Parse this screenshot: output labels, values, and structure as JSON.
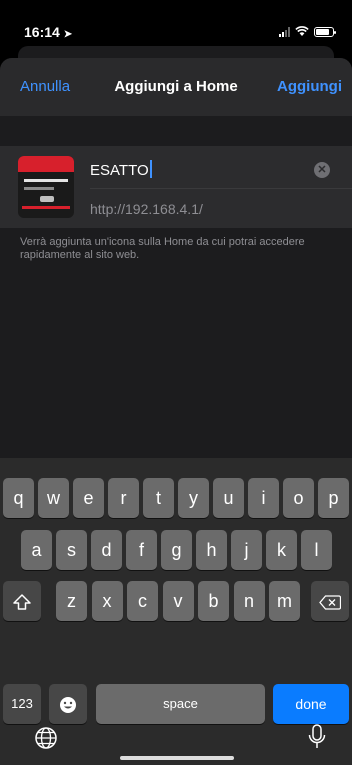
{
  "status": {
    "time": "16:14",
    "battery_level": 0.8
  },
  "nav": {
    "cancel": "Annulla",
    "title": "Aggiungi a Home",
    "add": "Aggiungi"
  },
  "bookmark": {
    "name": "ESATTO",
    "url": "http://192.168.4.1/"
  },
  "description": "Verrà aggiunta un'icona sulla Home da cui potrai accedere rapidamente al sito web.",
  "keyboard": {
    "row1": [
      "q",
      "w",
      "e",
      "r",
      "t",
      "y",
      "u",
      "i",
      "o",
      "p"
    ],
    "row2": [
      "a",
      "s",
      "d",
      "f",
      "g",
      "h",
      "j",
      "k",
      "l"
    ],
    "row3": [
      "z",
      "x",
      "c",
      "v",
      "b",
      "n",
      "m"
    ],
    "numbers": "123",
    "space": "space",
    "done": "done"
  },
  "icons": [
    "location-arrow-icon",
    "signal-icon",
    "wifi-icon",
    "battery-icon",
    "clear-icon",
    "shift-icon",
    "backspace-icon",
    "emoji-icon",
    "globe-icon",
    "mic-icon"
  ]
}
